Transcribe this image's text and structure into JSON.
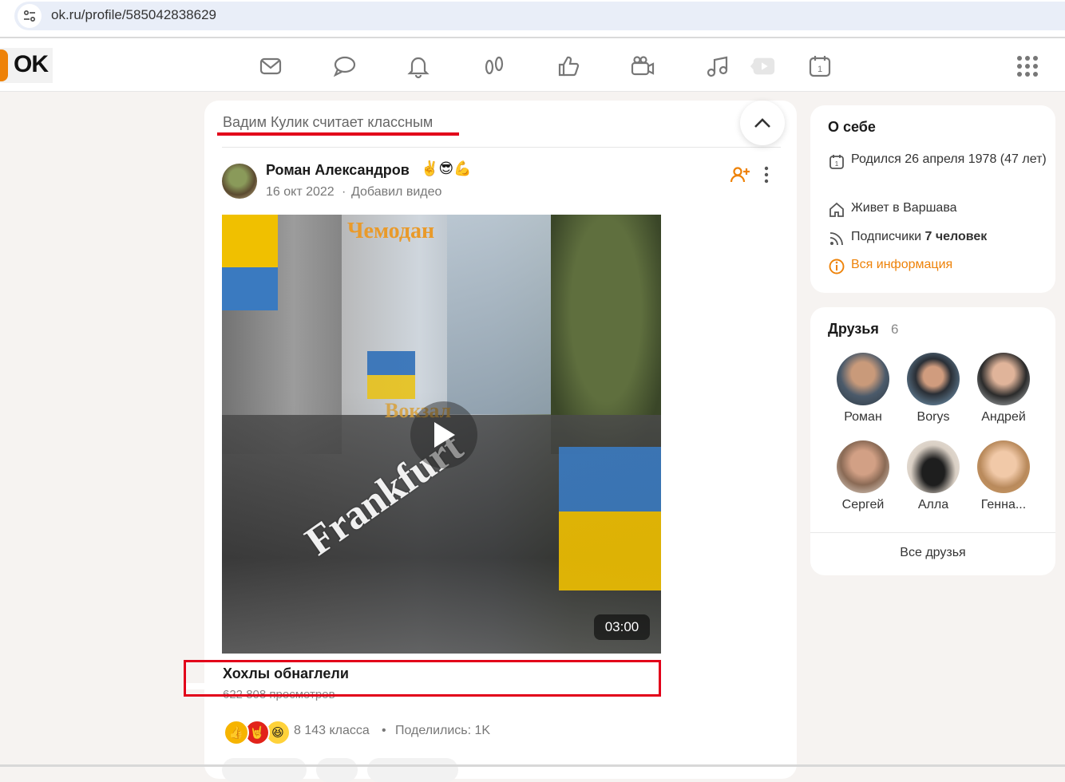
{
  "browser": {
    "url": "ok.ru/profile/585042838629"
  },
  "nav": {
    "logo": "OK",
    "icons": [
      "mail-icon",
      "chat-icon",
      "bell-icon",
      "guests-icon",
      "like-icon",
      "video-camera-icon",
      "music-icon",
      "video-play-icon",
      "calendar-icon",
      "apps-grid-icon"
    ]
  },
  "feed": {
    "liked_by": "Вадим Кулик считает классным",
    "post": {
      "author": "Роман Александров",
      "emojis": "✌️😎💪",
      "date": "16 окт 2022",
      "separator": "·",
      "action": "Добавил видео",
      "video": {
        "overlay_top": "Чемодан",
        "overlay_middle": "Вокзал",
        "overlay_watermark": "Frankfurt",
        "duration": "03:00",
        "title": "Хохлы обнаглели",
        "views": "622 808 просмотров"
      },
      "reactions": {
        "emoji_1": "👍",
        "emoji_2": "🤘",
        "emoji_3": "😆",
        "count": "8 143 класса",
        "dot": "•",
        "shared": "Поделились: 1K"
      }
    }
  },
  "about": {
    "title": "О себе",
    "born": "Родился 26 апреля 1978 (47 лет)",
    "lives": "Живет в Варшава",
    "subscribers_label": "Подписчики",
    "subscribers_value": "7 человек",
    "all_info": "Вся информация",
    "accent": "#ee8208"
  },
  "friends": {
    "title": "Друзья",
    "count": "6",
    "items": [
      {
        "name": "Роман"
      },
      {
        "name": "Borys"
      },
      {
        "name": "Андрей"
      },
      {
        "name": "Сергей"
      },
      {
        "name": "Алла"
      },
      {
        "name": "Генна..."
      }
    ],
    "all_link": "Все друзья"
  },
  "colors": {
    "brand": "#ee8208",
    "annotation_red": "#e2001a"
  }
}
